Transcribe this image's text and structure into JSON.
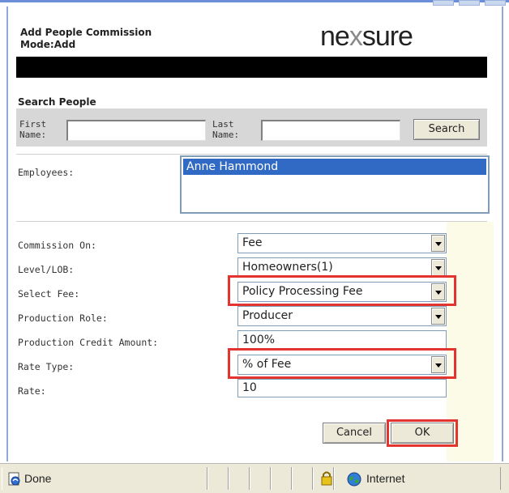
{
  "dialog": {
    "title_line1": "Add People Commission",
    "title_line2": "Mode:Add",
    "logo_left": "ne",
    "logo_x": "x",
    "logo_right": "sure"
  },
  "search": {
    "section_title": "Search People",
    "first_name_label_1": "First",
    "first_name_label_2": "Name:",
    "first_name_value": "",
    "last_name_label_1": "Last",
    "last_name_label_2": "Name:",
    "last_name_value": "",
    "search_button": "Search"
  },
  "employees": {
    "label": "Employees:",
    "items": [
      "Anne  Hammond"
    ],
    "selected_index": 0
  },
  "form": {
    "commission_on": {
      "label": "Commission On:",
      "value": "Fee"
    },
    "level_lob": {
      "label": "Level/LOB:",
      "value": "Homeowners(1)"
    },
    "select_fee": {
      "label": "Select Fee:",
      "value": "Policy Processing Fee"
    },
    "production_role": {
      "label": "Production Role:",
      "value": "Producer"
    },
    "production_credit_amount": {
      "label": "Production Credit Amount:",
      "value": "100%"
    },
    "rate_type": {
      "label": "Rate Type:",
      "value": "% of Fee"
    },
    "rate": {
      "label": "Rate:",
      "value": "10"
    }
  },
  "buttons": {
    "cancel": "Cancel",
    "ok": "OK"
  },
  "statusbar": {
    "status_text": "Done",
    "zone_text": "Internet"
  },
  "colors": {
    "highlight_red": "#e3342f",
    "selection_blue": "#316ac5"
  }
}
